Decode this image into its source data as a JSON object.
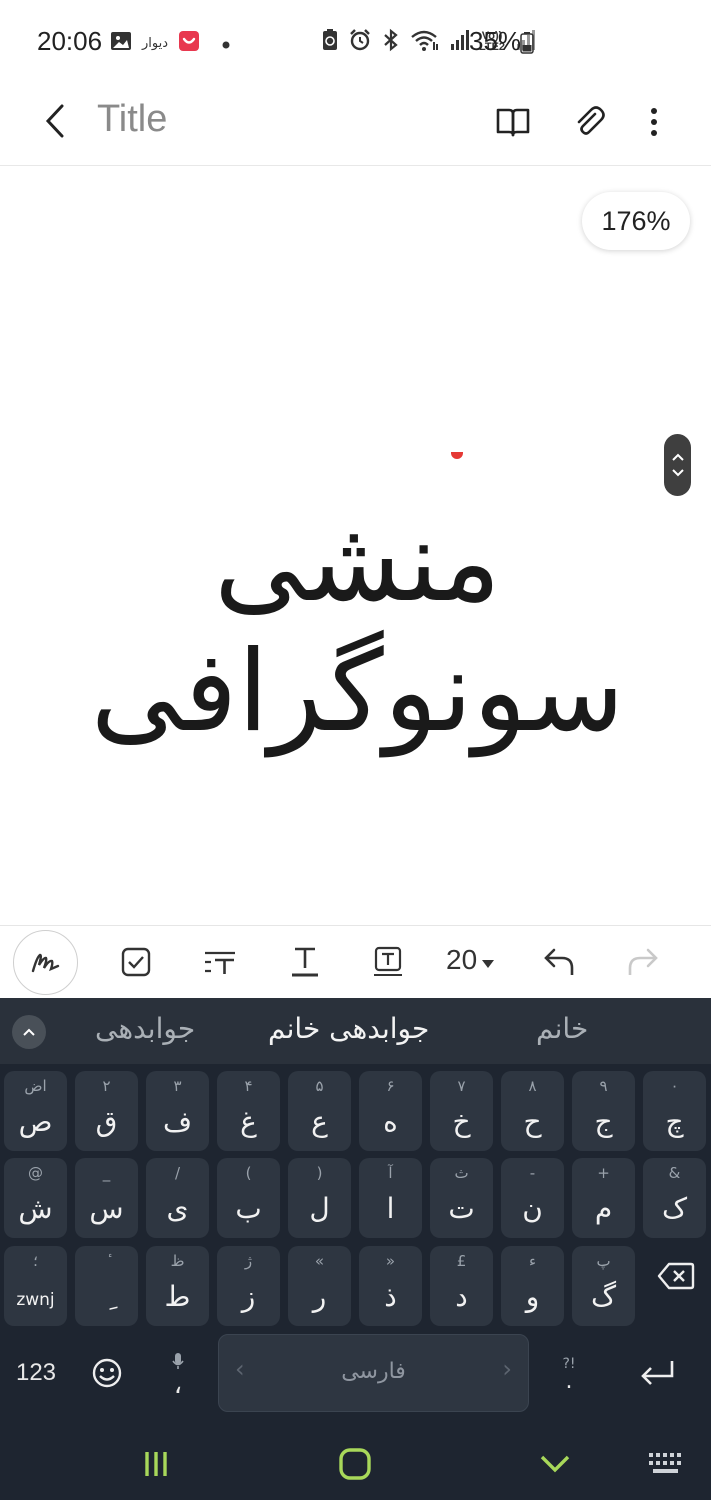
{
  "status_bar": {
    "time": "20:06",
    "divar_label": "دیوار",
    "lte_label": "Vo)) LTE2",
    "battery_percent": "35%",
    "left_icons": [
      "gallery-icon",
      "divar-app-icon",
      "red-app-icon",
      "notification-dot-icon"
    ],
    "right_icons": [
      "battery-saver-icon",
      "alarm-icon",
      "bluetooth-icon",
      "wifi-icon",
      "signal-icon",
      "signal-icon-2",
      "battery-icon"
    ]
  },
  "header": {
    "back_icon": "chevron-left-icon",
    "title_placeholder": "Title",
    "actions": [
      "reading-mode-icon",
      "attach-icon",
      "more-options-icon"
    ]
  },
  "canvas": {
    "zoom_level": "176%",
    "handwritten_text": "منشی سونوگرافی",
    "scroll_handle_icon": "scroll-up-down-icon"
  },
  "toolbar": {
    "tools": [
      "pen-tool-icon",
      "checkbox-icon",
      "text-style-icon",
      "underline-text-icon",
      "text-box-icon"
    ],
    "font_size": "20",
    "undo_icon": "undo-icon",
    "redo_icon": "redo-icon"
  },
  "keyboard": {
    "suggestions": [
      "جوابدهی",
      "جوابدهی خانم",
      "خانم"
    ],
    "row1": [
      {
        "hint": "اض",
        "main": "ص"
      },
      {
        "hint": "۲",
        "main": "ق"
      },
      {
        "hint": "۳",
        "main": "ف"
      },
      {
        "hint": "۴",
        "main": "غ"
      },
      {
        "hint": "۵",
        "main": "ع"
      },
      {
        "hint": "۶",
        "main": "ه"
      },
      {
        "hint": "۷",
        "main": "خ"
      },
      {
        "hint": "۸",
        "main": "ح"
      },
      {
        "hint": "۹",
        "main": "ج"
      },
      {
        "hint": "۰",
        "main": "چ"
      }
    ],
    "row2": [
      {
        "hint": "@",
        "main": "ش"
      },
      {
        "hint": "_",
        "main": "س"
      },
      {
        "hint": "/",
        "main": "ی"
      },
      {
        "hint": "(",
        "main": "ب"
      },
      {
        "hint": ")",
        "main": "ل"
      },
      {
        "hint": "آ",
        "main": "ا"
      },
      {
        "hint": "ث",
        "main": "ت"
      },
      {
        "hint": "-",
        "main": "ن"
      },
      {
        "hint": "+",
        "main": "م"
      },
      {
        "hint": "&",
        "main": "ک"
      }
    ],
    "row3": [
      {
        "hint": "؛",
        "main": "zwnj"
      },
      {
        "hint": "ٔ",
        "main": "ِ"
      },
      {
        "hint": "ظ",
        "main": "ط"
      },
      {
        "hint": "ژ",
        "main": "ز"
      },
      {
        "hint": "«",
        "main": "ر"
      },
      {
        "hint": "»",
        "main": "ذ"
      },
      {
        "hint": "£",
        "main": "د"
      },
      {
        "hint": "ء",
        "main": "و"
      },
      {
        "hint": "پ",
        "main": "گ"
      }
    ],
    "numbers_key": "123",
    "emoji_icon": "emoji-icon",
    "mic_comma": "،",
    "space_label": "فارسی",
    "space_prev": "‹",
    "space_next": "›",
    "punct_hint": "?!",
    "punct_main": ".",
    "backspace_icon": "backspace-icon",
    "enter_icon": "enter-icon"
  },
  "nav_bar": {
    "buttons": [
      "recent-apps-icon",
      "home-icon",
      "hide-keyboard-icon",
      "keyboard-switch-icon"
    ]
  }
}
